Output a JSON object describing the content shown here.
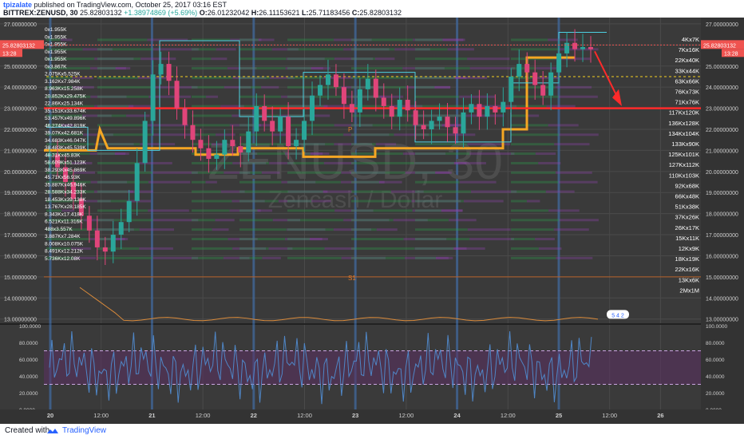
{
  "header": {
    "author": "tpizalate",
    "published": "published on TradingView.com, October 25, 2017 03:16 EST",
    "symbol": "BITTREX:ZENUSD, 30",
    "last": "25.82803132",
    "change": "+1.38974869 (+5.69%)",
    "ohlc_o_label": "O:",
    "ohlc_o": "26.01232042",
    "ohlc_h_label": "H:",
    "ohlc_h": "26.11153621",
    "ohlc_l_label": "L:",
    "ohlc_l": "25.71183456",
    "ohlc_c_label": "C:",
    "ohlc_c": "25.82803132"
  },
  "footer": {
    "created": "Created with",
    "brand": "TradingView"
  },
  "watermark": {
    "symbol": "ZENUSD, 30",
    "name": "Zencash / Dollar"
  },
  "colors": {
    "background": "#3a3a3a",
    "grid": "#4a4a4a",
    "session_line": "#3d6fb0",
    "up_candle": "#2aa69a",
    "down_candle": "#e0457a",
    "resistance": "#ff2a2a",
    "step_line": "#f5a623",
    "vp_up": "#2e9e4e",
    "vp_down": "#8e44ad",
    "price_badge": "#ef5350",
    "rsi_line": "#4f86c6",
    "rsi_band": "#5b2f63"
  },
  "price_badge": {
    "price": "25.82803132",
    "time": "13:28"
  },
  "chart_data": {
    "type": "candlestick",
    "title": "BITTREX:ZENUSD, 30",
    "price_axis": {
      "ylim": [
        12.8,
        27.3
      ],
      "ticks": [
        {
          "value": 27,
          "label": "27.00000000"
        },
        {
          "value": 26,
          "label": "26.00000000"
        },
        {
          "value": 25,
          "label": "25.00000000"
        },
        {
          "value": 24,
          "label": "24.00000000"
        },
        {
          "value": 23,
          "label": "23.00000000"
        },
        {
          "value": 22,
          "label": "22.00000000"
        },
        {
          "value": 21,
          "label": "21.00000000"
        },
        {
          "value": 20,
          "label": "20.00000000"
        },
        {
          "value": 19,
          "label": "19.00000000"
        },
        {
          "value": 18,
          "label": "18.00000000"
        },
        {
          "value": 17,
          "label": "17.00000000"
        },
        {
          "value": 16,
          "label": "16.00000000"
        },
        {
          "value": 15,
          "label": "15.00000000"
        },
        {
          "value": 14,
          "label": "14.00000000"
        },
        {
          "value": 13,
          "label": "13.00000000"
        }
      ]
    },
    "time_axis": {
      "labels": [
        "20",
        "12:00",
        "21",
        "12:00",
        "22",
        "12:00",
        "23",
        "12:00",
        "24",
        "12:00",
        "25",
        "12:00",
        "26"
      ]
    },
    "session_breaks": [
      "20",
      "21",
      "22",
      "23",
      "24",
      "25"
    ],
    "support_resistance": {
      "resistance": 23.0,
      "s1_label": "S1",
      "s1": 15.0,
      "p_label": "P",
      "p": 22.0
    },
    "closes": [
      20.8,
      20.2,
      19.5,
      18.7,
      17.9,
      17.2,
      16.4,
      16.2,
      17.0,
      17.6,
      18.6,
      20.4,
      22.4,
      24.6,
      25.1,
      24.3,
      23.0,
      22.2,
      21.5,
      21.1,
      20.6,
      20.8,
      21.5,
      21.2,
      20.9,
      21.9,
      23.1,
      22.4,
      21.9,
      22.6,
      21.2,
      21.5,
      22.4,
      23.6,
      24.1,
      24.6,
      24.0,
      23.2,
      22.8,
      23.9,
      24.4,
      23.5,
      23.1,
      22.6,
      23.4,
      22.9,
      22.2,
      22.0,
      22.4,
      22.6,
      22.1,
      21.8,
      22.8,
      23.2,
      22.6,
      23.1,
      22.8,
      23.3,
      24.5,
      25.1,
      24.7,
      24.1,
      23.6,
      24.7,
      25.6,
      26.1,
      25.8,
      25.9,
      25.8
    ],
    "right_labels": [
      "4Kx7K",
      "7Kx16K",
      "22Kx40K",
      "33Kx44K",
      "63Kx66K",
      "76Kx73K",
      "71Kx76K",
      "117Kx120K",
      "136Kx128K",
      "134Kx104K",
      "133Kx90K",
      "125Kx101K",
      "127Kx112K",
      "110Kx103K",
      "92Kx68K",
      "66Kx48K",
      "51Kx38K",
      "37Kx26K",
      "26Kx17K",
      "15Kx11K",
      "12Kx9K",
      "18Kx19K",
      "22Kx16K",
      "13Kx6K",
      "2Mx1M"
    ],
    "left_labels": [
      "0x1.955K",
      "0x1.955K",
      "0x1.955K",
      "0x1.955K",
      "0x1.955K",
      "0x3.867K",
      "2.075Kx5.525K",
      "3.162Kx7.984K",
      "8.963Kx15.258K",
      "20.852Kx29.475K",
      "22.86Kx25.134K",
      "35.151Kx33.674K",
      "53.457Kx49.896K",
      "46.274Kx42.819K",
      "39.07Kx42.681K",
      "34.683Kx46.047K",
      "38.483Kx45.539K",
      "48.31Kx45.83K",
      "58.609Kx51.123K",
      "38.293Kx45.869K",
      "45.71Kx56.93K",
      "35.887Kx46.946K",
      "28.588Kx34.233K",
      "18.453Kx39.138K",
      "13.767Kx28.185K",
      "8.343Kx17.418K",
      "6.521Kx11.316K",
      "488x3.557K",
      "3.887Kx7.284K",
      "8.008Kx10.075K",
      "8.491Kx12.212K",
      "5.736Kx12.08K"
    ],
    "indicator_badge": "5 4 2",
    "oscillator": {
      "ylim": [
        0,
        100
      ],
      "ticks": [
        {
          "value": 100,
          "label": "100.0000"
        },
        {
          "value": 80,
          "label": "80.0000"
        },
        {
          "value": 60,
          "label": "60.0000"
        },
        {
          "value": 40,
          "label": "40.0000"
        },
        {
          "value": 20,
          "label": "20.0000"
        },
        {
          "value": 0,
          "label": "0.0000"
        }
      ],
      "band": [
        30,
        70
      ]
    }
  }
}
